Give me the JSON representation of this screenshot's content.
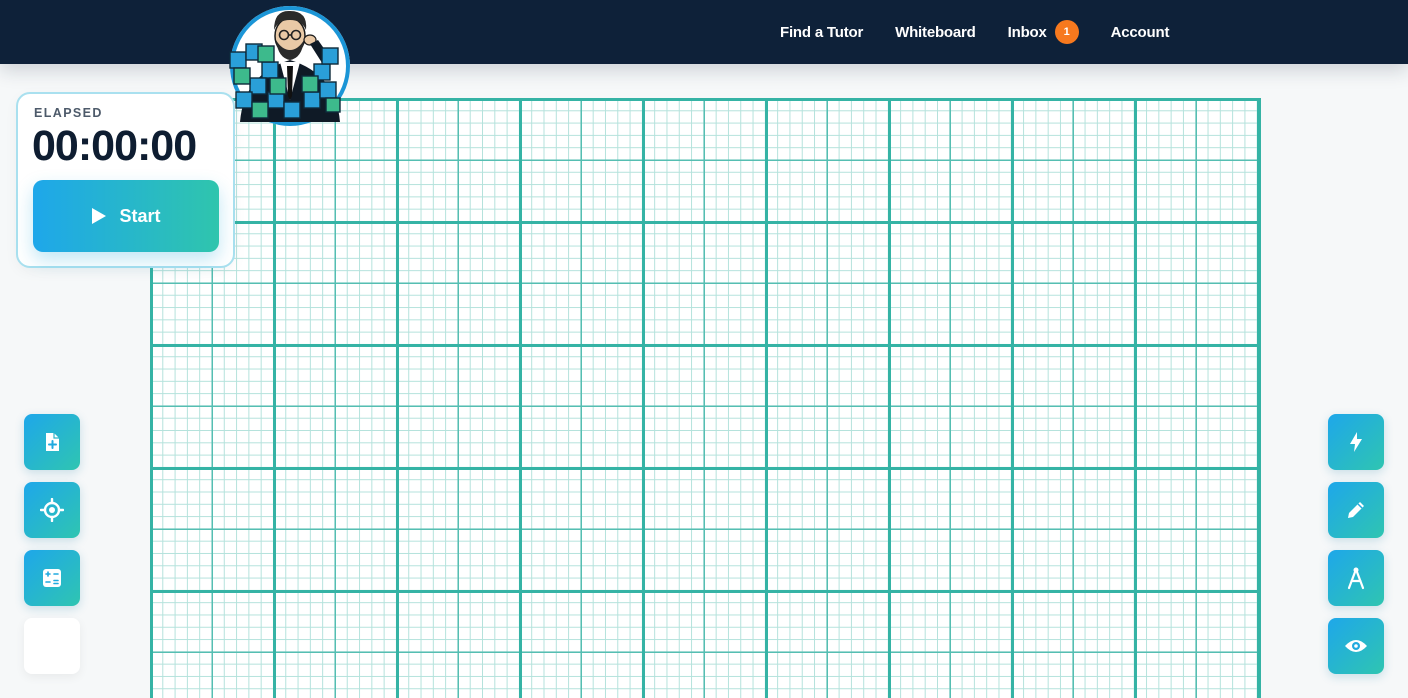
{
  "nav": {
    "find_tutor": "Find a Tutor",
    "whiteboard": "Whiteboard",
    "inbox": "Inbox",
    "inbox_count": "1",
    "account": "Account"
  },
  "timer": {
    "label": "ELAPSED",
    "value": "00:00:00",
    "start_label": "Start"
  },
  "colors": {
    "topbar": "#0e2139",
    "accent_start": "#1ea7ea",
    "accent_end": "#2fc5ad",
    "badge": "#f7791e",
    "grid": "#35b3a5"
  },
  "tools": {
    "left": [
      "file-plus-icon",
      "crosshair-icon",
      "calculator-icon",
      "sidebar-toggle-icon"
    ],
    "right": [
      "lightning-icon",
      "pencil-icon",
      "compass-icon",
      "eye-icon"
    ]
  }
}
